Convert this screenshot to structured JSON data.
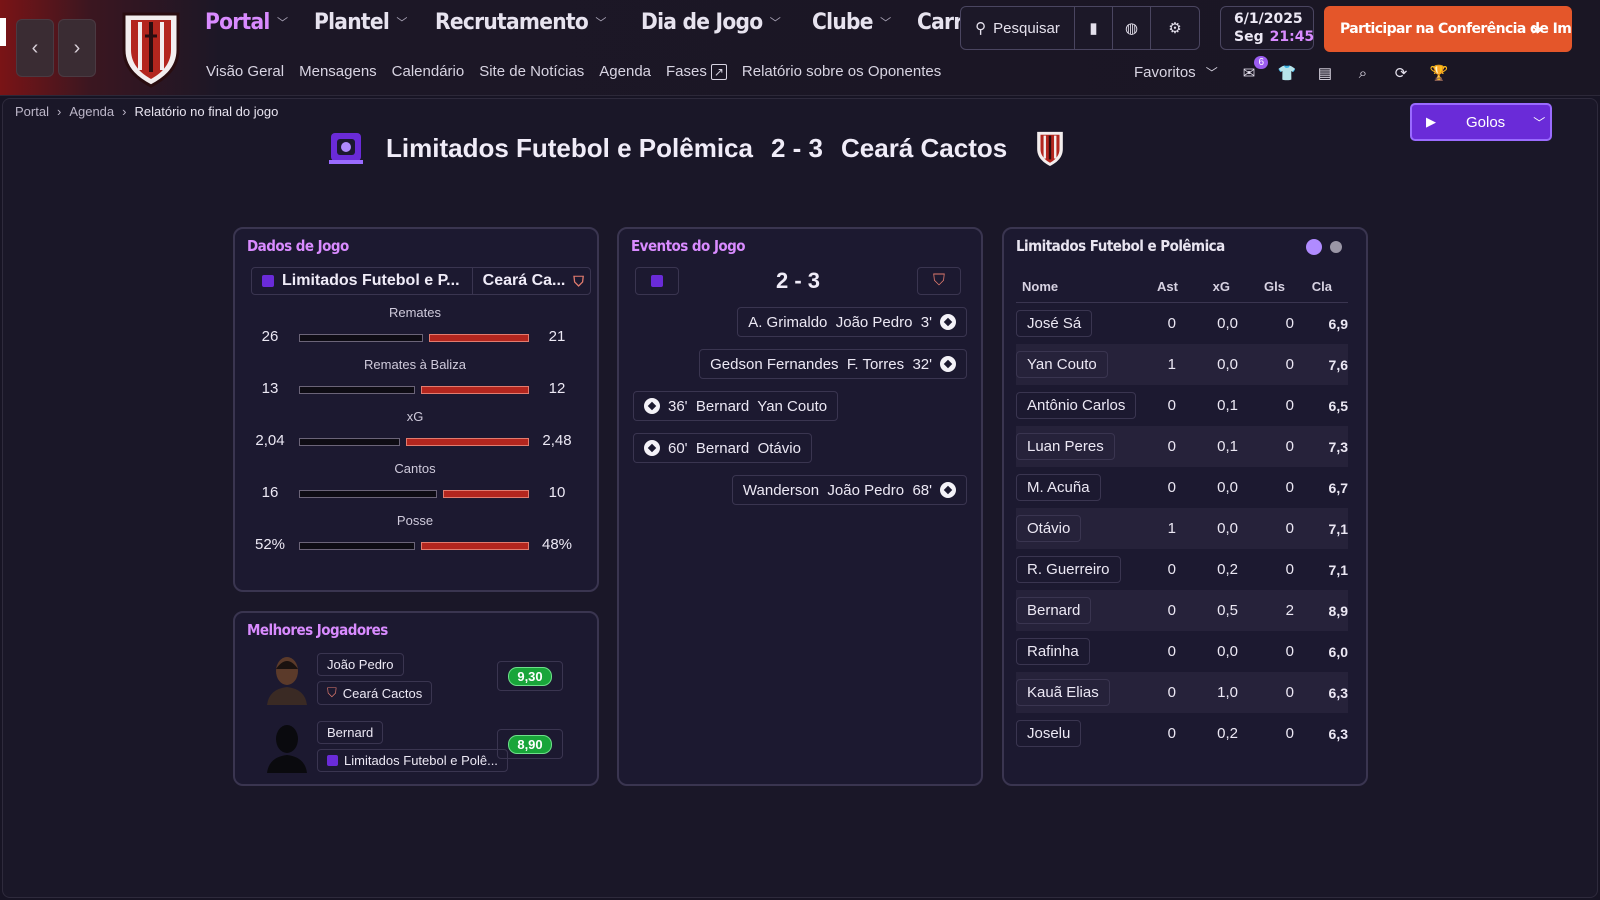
{
  "nav": {
    "main": [
      {
        "label": "Portal",
        "active": true
      },
      {
        "label": "Plantel",
        "active": false
      },
      {
        "label": "Recrutamento",
        "active": false
      },
      {
        "label": "Dia de Jogo",
        "active": false
      },
      {
        "label": "Clube",
        "active": false
      },
      {
        "label": "Carreira",
        "active": false
      }
    ],
    "sub": [
      "Visão Geral",
      "Mensagens",
      "Calendário",
      "Site de Notícias",
      "Agenda",
      "Fases",
      "Relatório sobre os Oponentes"
    ],
    "search_label": "Pesquisar",
    "date": "6/1/2025",
    "weekday": "Seg",
    "time": "21:45",
    "press_button": "Participar na Conferência de Imprensa",
    "favorites": "Favoritos",
    "messages_badge": "6"
  },
  "breadcrumb": [
    "Portal",
    "Agenda",
    "Relatório no final do jogo"
  ],
  "highlights_button": "Golos",
  "match": {
    "home": "Limitados Futebol e Polêmica",
    "away": "Ceará Cactos",
    "score": "2 - 3"
  },
  "match_data": {
    "title": "Dados de Jogo",
    "home_short": "Limitados Futebol e P...",
    "away_short": "Ceará Ca...",
    "stats": [
      {
        "label": "Remates",
        "home": "26",
        "away": "21",
        "home_val": 26,
        "away_val": 21
      },
      {
        "label": "Remates à Baliza",
        "home": "13",
        "away": "12",
        "home_val": 13,
        "away_val": 12
      },
      {
        "label": "xG",
        "home": "2,04",
        "away": "2,48",
        "home_val": 2.04,
        "away_val": 2.48
      },
      {
        "label": "Cantos",
        "home": "16",
        "away": "10",
        "home_val": 16,
        "away_val": 10
      },
      {
        "label": "Posse",
        "home": "52%",
        "away": "48%",
        "home_val": 52,
        "away_val": 48
      }
    ]
  },
  "top_players": {
    "title": "Melhores Jogadores",
    "players": [
      {
        "name": "João Pedro",
        "team": "Ceará Cactos",
        "rating": "9,30"
      },
      {
        "name": "Bernard",
        "team": "Limitados Futebol e Polê...",
        "rating": "8,90"
      }
    ]
  },
  "events": {
    "title": "Eventos do Jogo",
    "score": "2 - 3",
    "items": [
      {
        "side": "away",
        "text": "A. Grimaldo  João Pedro  3'"
      },
      {
        "side": "away",
        "text": "Gedson Fernandes  F. Torres  32'"
      },
      {
        "side": "home",
        "text": "36'  Bernard  Yan Couto"
      },
      {
        "side": "home",
        "text": "60'  Bernard  Otávio"
      },
      {
        "side": "away",
        "text": "Wanderson  João Pedro  68'"
      }
    ]
  },
  "player_stats": {
    "title": "Limitados Futebol e Polêmica",
    "columns": [
      "Nome",
      "Ast",
      "xG",
      "Gls",
      "Cla"
    ],
    "rows": [
      [
        "José Sá",
        "0",
        "0,0",
        "0",
        "6,9"
      ],
      [
        "Yan Couto",
        "1",
        "0,0",
        "0",
        "7,6"
      ],
      [
        "Antônio Carlos",
        "0",
        "0,1",
        "0",
        "6,5"
      ],
      [
        "Luan Peres",
        "0",
        "0,1",
        "0",
        "7,3"
      ],
      [
        "M. Acuña",
        "0",
        "0,0",
        "0",
        "6,7"
      ],
      [
        "Otávio",
        "1",
        "0,0",
        "0",
        "7,1"
      ],
      [
        "R. Guerreiro",
        "0",
        "0,2",
        "0",
        "7,1"
      ],
      [
        "Bernard",
        "0",
        "0,5",
        "2",
        "8,9"
      ],
      [
        "Rafinha",
        "0",
        "0,0",
        "0",
        "6,0"
      ],
      [
        "Kauã Elias",
        "0",
        "1,0",
        "0",
        "6,3"
      ],
      [
        "Joselu",
        "0",
        "0,2",
        "0",
        "6,3"
      ]
    ]
  },
  "colors": {
    "accent": "#d98bff",
    "home_bar": "#0e0c14",
    "away_bar": "#b3261e",
    "press_button": "#e4562a",
    "rating_green": "#19a53a",
    "highlights_button": "#6a2bd8"
  }
}
